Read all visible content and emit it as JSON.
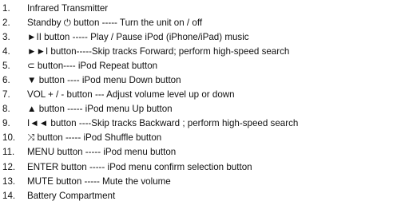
{
  "items": [
    {
      "num": "1.",
      "text": "Infrared Transmitter"
    },
    {
      "num": "2.",
      "text": "Standby ⏻ button ----- Turn the unit on / off"
    },
    {
      "num": "3.",
      "text": "►II button ----- Play / Pause iPod  (iPhone/iPad) music"
    },
    {
      "num": "4.",
      "text": "►►I  button-----Skip tracks Forward; perform high-speed search"
    },
    {
      "num": "5.",
      "text": "⊂ button---- iPod  Repeat button"
    },
    {
      "num": "6.",
      "text": "▼ button ---- iPod menu Down button"
    },
    {
      "num": "7.",
      "text": "VOL + / - button --- Adjust volume level up or down"
    },
    {
      "num": "8.",
      "text": "▲ button ----- iPod menu Up button"
    },
    {
      "num": "9.",
      "text": "I◄◄  button ----Skip tracks Backward ; perform high-speed search"
    },
    {
      "num": "10.",
      "text": "⤨ button ----- iPod Shuffle button"
    },
    {
      "num": "11.",
      "text": "MENU button ----- iPod menu button"
    },
    {
      "num": "12.",
      "text": "ENTER button ----- iPod menu confirm selection button"
    },
    {
      "num": "13.",
      "text": "MUTE button ----- Mute the volume"
    },
    {
      "num": "14.",
      "text": "Battery Compartment"
    }
  ]
}
